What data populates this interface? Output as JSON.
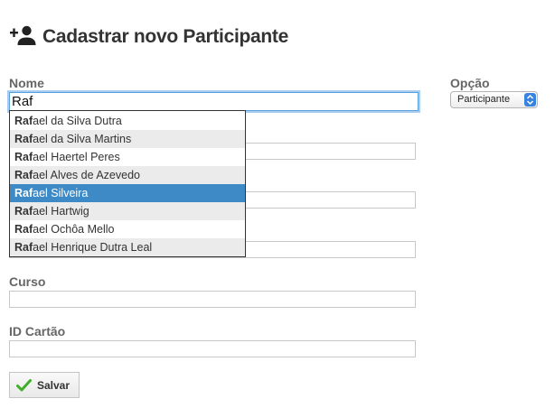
{
  "page": {
    "title": "Cadastrar novo Participante",
    "icon": "add-person-icon"
  },
  "form": {
    "nome": {
      "label": "Nome",
      "value": "Raf"
    },
    "opcao": {
      "label": "Opção",
      "selected": "Participante"
    },
    "curso": {
      "label": "Curso",
      "value": ""
    },
    "id_cartao": {
      "label": "ID Cartão",
      "value": ""
    },
    "save_label": "Salvar",
    "save_icon": "checkmark-icon"
  },
  "autocomplete": {
    "query": "Raf",
    "items": [
      {
        "match": "Raf",
        "rest": "ael da Silva Dutra"
      },
      {
        "match": "Raf",
        "rest": "ael da Silva Martins"
      },
      {
        "match": "Raf",
        "rest": "ael Haertel Peres"
      },
      {
        "match": "Raf",
        "rest": "ael Alves de Azevedo"
      },
      {
        "match": "Raf",
        "rest": "ael Silveira"
      },
      {
        "match": "Raf",
        "rest": "ael Hartwig"
      },
      {
        "match": "Raf",
        "rest": "ael Ochôa Mello"
      },
      {
        "match": "Raf",
        "rest": "ael Henrique Dutra Leal"
      }
    ],
    "active_index": 4
  },
  "colors": {
    "highlight": "#3e8ac7",
    "save_check": "#3fae2a"
  }
}
